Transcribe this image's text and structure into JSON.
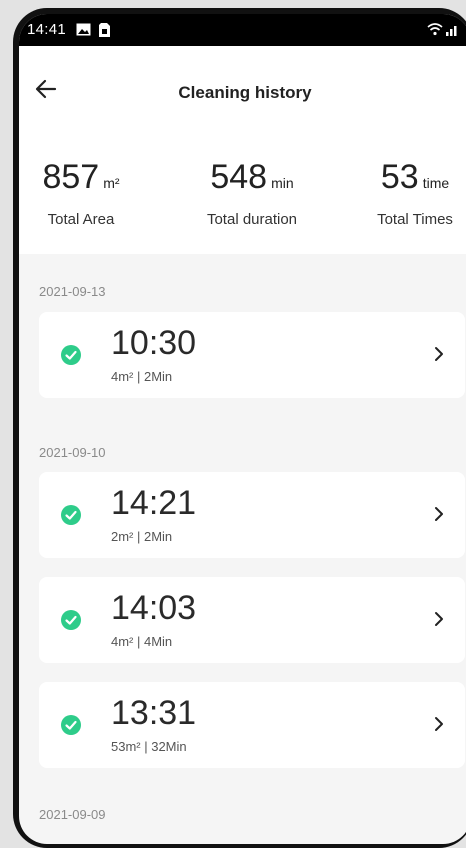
{
  "status_bar": {
    "time": "14:41"
  },
  "header": {
    "title": "Cleaning history"
  },
  "stats": [
    {
      "value": "857",
      "unit": "m²",
      "label": "Total Area"
    },
    {
      "value": "548",
      "unit": "min",
      "label": "Total duration"
    },
    {
      "value": "53",
      "unit": "time",
      "label": "Total Times"
    }
  ],
  "groups": [
    {
      "date": "2021-09-13",
      "records": [
        {
          "time": "10:30",
          "area": "4m²",
          "duration": "2Min",
          "detail": "4m²  |  2Min"
        }
      ]
    },
    {
      "date": "2021-09-10",
      "records": [
        {
          "time": "14:21",
          "area": "2m²",
          "duration": "2Min",
          "detail": "2m²  |  2Min"
        },
        {
          "time": "14:03",
          "area": "4m²",
          "duration": "4Min",
          "detail": "4m²  |  4Min"
        },
        {
          "time": "13:31",
          "area": "53m²",
          "duration": "32Min",
          "detail": "53m²  |  32Min"
        }
      ]
    },
    {
      "date": "2021-09-09",
      "records": []
    }
  ],
  "colors": {
    "accent": "#2ecc8a",
    "background": "#f5f5f5"
  },
  "icons": {
    "back": "arrow-left-icon",
    "status": "check-circle-icon",
    "chevron": "chevron-right-icon"
  }
}
